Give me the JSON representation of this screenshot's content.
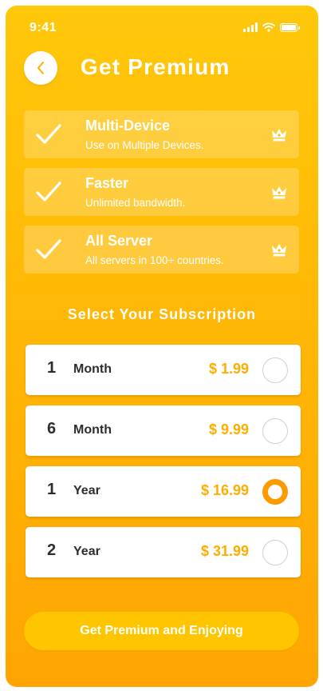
{
  "status_bar": {
    "time": "9:41"
  },
  "header": {
    "title": "Get Premium"
  },
  "features": [
    {
      "title": "Multi-Device",
      "subtitle": "Use on Multiple Devices."
    },
    {
      "title": "Faster",
      "subtitle": "Unlimited bandwidth."
    },
    {
      "title": "All Server",
      "subtitle": "All servers in 100+ countries."
    }
  ],
  "section_title": "Select Your Subscription",
  "plans": [
    {
      "number": "1",
      "unit": "Month",
      "price": "$ 1.99",
      "selected": false
    },
    {
      "number": "6",
      "unit": "Month",
      "price": "$ 9.99",
      "selected": false
    },
    {
      "number": "1",
      "unit": "Year",
      "price": "$ 16.99",
      "selected": true
    },
    {
      "number": "2",
      "unit": "Year",
      "price": "$ 31.99",
      "selected": false
    }
  ],
  "cta_label": "Get Premium and Enjoying",
  "colors": {
    "background_top": "#ffc80b",
    "background_bottom": "#ffa503",
    "price": "#ffae00",
    "radio_selected": "#ff9900",
    "button": "#ffc600"
  },
  "icons": {
    "back": "chevron-left-icon",
    "feature_check": "checkmark-icon",
    "feature_badge": "crown-icon"
  }
}
